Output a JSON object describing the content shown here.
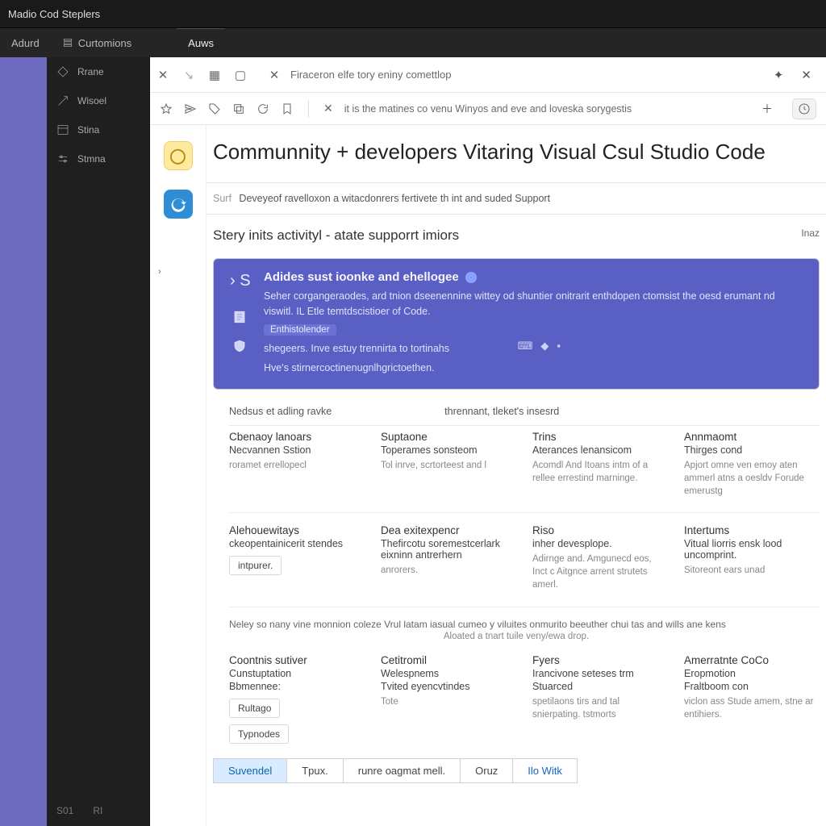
{
  "titlebar": {
    "text": "Madio Cod Steplers"
  },
  "menubar": {
    "items": [
      "Adurd",
      "Curtomions"
    ],
    "right_tab": "Auws"
  },
  "sidebar": {
    "items": [
      {
        "label": "Rrane"
      },
      {
        "label": "Wisoel"
      },
      {
        "label": "Stina"
      },
      {
        "label": "Stmna"
      }
    ],
    "status": {
      "a": "S01",
      "b": "RI"
    }
  },
  "editor": {
    "tab_close_glyph": "✕",
    "address": "Firaceron elfe tory eniny comettlop",
    "toolbar_caption": "it is the matines co venu Winyos and eve and loveska sorygestis",
    "plus": "＋",
    "right_icons": [
      "✦",
      "✕"
    ]
  },
  "page": {
    "title": "Communnity + developers Vitaring Visual Csul Studio Code",
    "crumb_muted": "Surf",
    "crumb": "Deveyeof ravelloxon a witacdonrers fertivete th int and suded Support",
    "section_title": "Stery inits activityl - atate supporrt imiors",
    "section_corner": "Inaz",
    "hero": {
      "heading": "Adides sust ioonke and ehellogee",
      "p1": "Seher corgangeraodes, ard tnion dseenennine wittey od shuntier onitrarit enthdopen ctomsist the oesd erumant nd viswitl. IL Etle temtdscistioer of Code.",
      "pill": "Enthistolender",
      "p2": "shegeers. Inve estuy trennirta to tortinahs",
      "p3": "Hve's stirnercoctinenugnlhgrictoethen."
    },
    "labels": {
      "a": "Nedsus et adling ravke",
      "b": "thrennant, tleket's insesrd"
    },
    "row1": [
      {
        "h": "Cbenaoy lanoars",
        "sub": "Necvannen Sstion",
        "desc": "roramet errellopecl"
      },
      {
        "h": "Suptaone",
        "sub": "Toperames sonsteom",
        "desc": "Tol inrve, scrtorteest and l"
      },
      {
        "h": "Trins",
        "sub": "Aterances lenansicom",
        "desc": "Acomdl\nAnd Itoans\nintm of a rellee errestind marninge."
      },
      {
        "h": "Annmaomt",
        "sub": "Thirges cond",
        "desc": "Apjort omne ven\nemoy aten\nammerl atns a oesldv\nForude emerustg"
      }
    ],
    "row2": [
      {
        "h": "Alehouewitays",
        "sub": "ckeopentainicerit stendes",
        "chip": "intpurer."
      },
      {
        "h": "Dea exitexpencr",
        "sub": "Thefircotu soremestcerlark eixninn antrerhern",
        "desc": "anrorers."
      },
      {
        "h": "Riso",
        "sub": "inher devesplope.",
        "desc": "Adirnge and.\nAmgunecd eos, Inct c Aitgnce arrent strutets amerl."
      },
      {
        "h": "Intertums",
        "sub": "Vitual liorris ensk lood uncomprint.",
        "desc": "Sitoreont ears unad"
      }
    ],
    "note": "Neley so nany vine monnion coleze Vrul latam iasual cumeo y viluites onmurito beeuther chui tas and wills ane kens",
    "note_sub": "Aloated a tnart tuile veny/ewa drop.",
    "row3": [
      {
        "h": "Coontnis sutiver",
        "sub": "Cunstuptation",
        "sub2": "Bbmennee:",
        "chip1": "Rultago",
        "chip2": "Typnodes"
      },
      {
        "h": "Cetitromil",
        "sub": "Welespnems",
        "sub2": "Tvited eyencvtindes",
        "desc": "Tote"
      },
      {
        "h": "Fyers",
        "sub": "Irancivone seteses trm",
        "sub2": "Stuarced",
        "desc": "spetilaons\ntirs and tal snierpating.\ntstmorts"
      },
      {
        "h": "Amerratnte CoCo",
        "sub": "Eropmotion",
        "sub2": "Fraltboom con",
        "desc": "viclon ass\nStude amem, stne ar\nentihiers."
      }
    ],
    "tabs": [
      "Suvendel",
      "Tpux.",
      "runre oagmat mell.",
      "Oruz",
      "Ilo Witk"
    ]
  }
}
